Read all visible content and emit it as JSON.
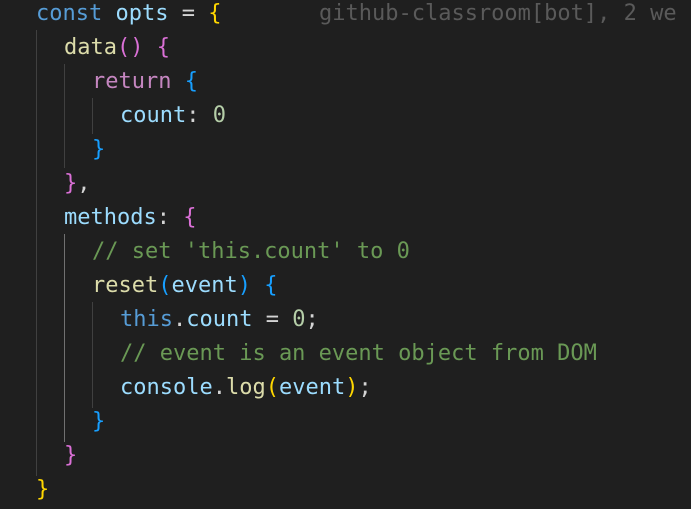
{
  "blame": {
    "text": "github-classroom[bot], 2 we"
  },
  "code": {
    "l1": {
      "kw": "const",
      "name": "opts",
      "eq": "=",
      "brace": "{"
    },
    "l2": {
      "fn": "data",
      "parens": "()",
      "brace": "{"
    },
    "l3": {
      "kw": "return",
      "brace": "{"
    },
    "l4": {
      "prop": "count",
      "colon": ":",
      "num": "0"
    },
    "l5": {
      "brace": "}"
    },
    "l6": {
      "brace": "}",
      "comma": ","
    },
    "l7": {
      "prop": "methods",
      "colon": ":",
      "brace": "{"
    },
    "l8": {
      "comment": "// set 'this.count' to 0"
    },
    "l9": {
      "fn": "reset",
      "paren_open": "(",
      "param": "event",
      "paren_close": ")",
      "brace": "{"
    },
    "l10": {
      "this": "this",
      "dot": ".",
      "prop": "count",
      "eq": "=",
      "num": "0",
      "semi": ";"
    },
    "l11": {
      "comment": "// event is an event object from DOM"
    },
    "l12": {
      "obj": "console",
      "dot": ".",
      "fn": "log",
      "paren_open": "(",
      "param": "event",
      "paren_close": ")",
      "semi": ";"
    },
    "l13": {
      "brace": "}"
    },
    "l14": {
      "brace": "}"
    },
    "l15": {
      "brace": "}"
    }
  },
  "colors": {
    "background": "#1f1f1f",
    "keyword": "#569cd6",
    "variable": "#9cdcfe",
    "function": "#dcdcaa",
    "control": "#c586c0",
    "number": "#b5cea8",
    "comment": "#6a9955",
    "bracket_level1": "#ffd700",
    "bracket_level2": "#da70d6",
    "bracket_level3": "#179fff"
  }
}
